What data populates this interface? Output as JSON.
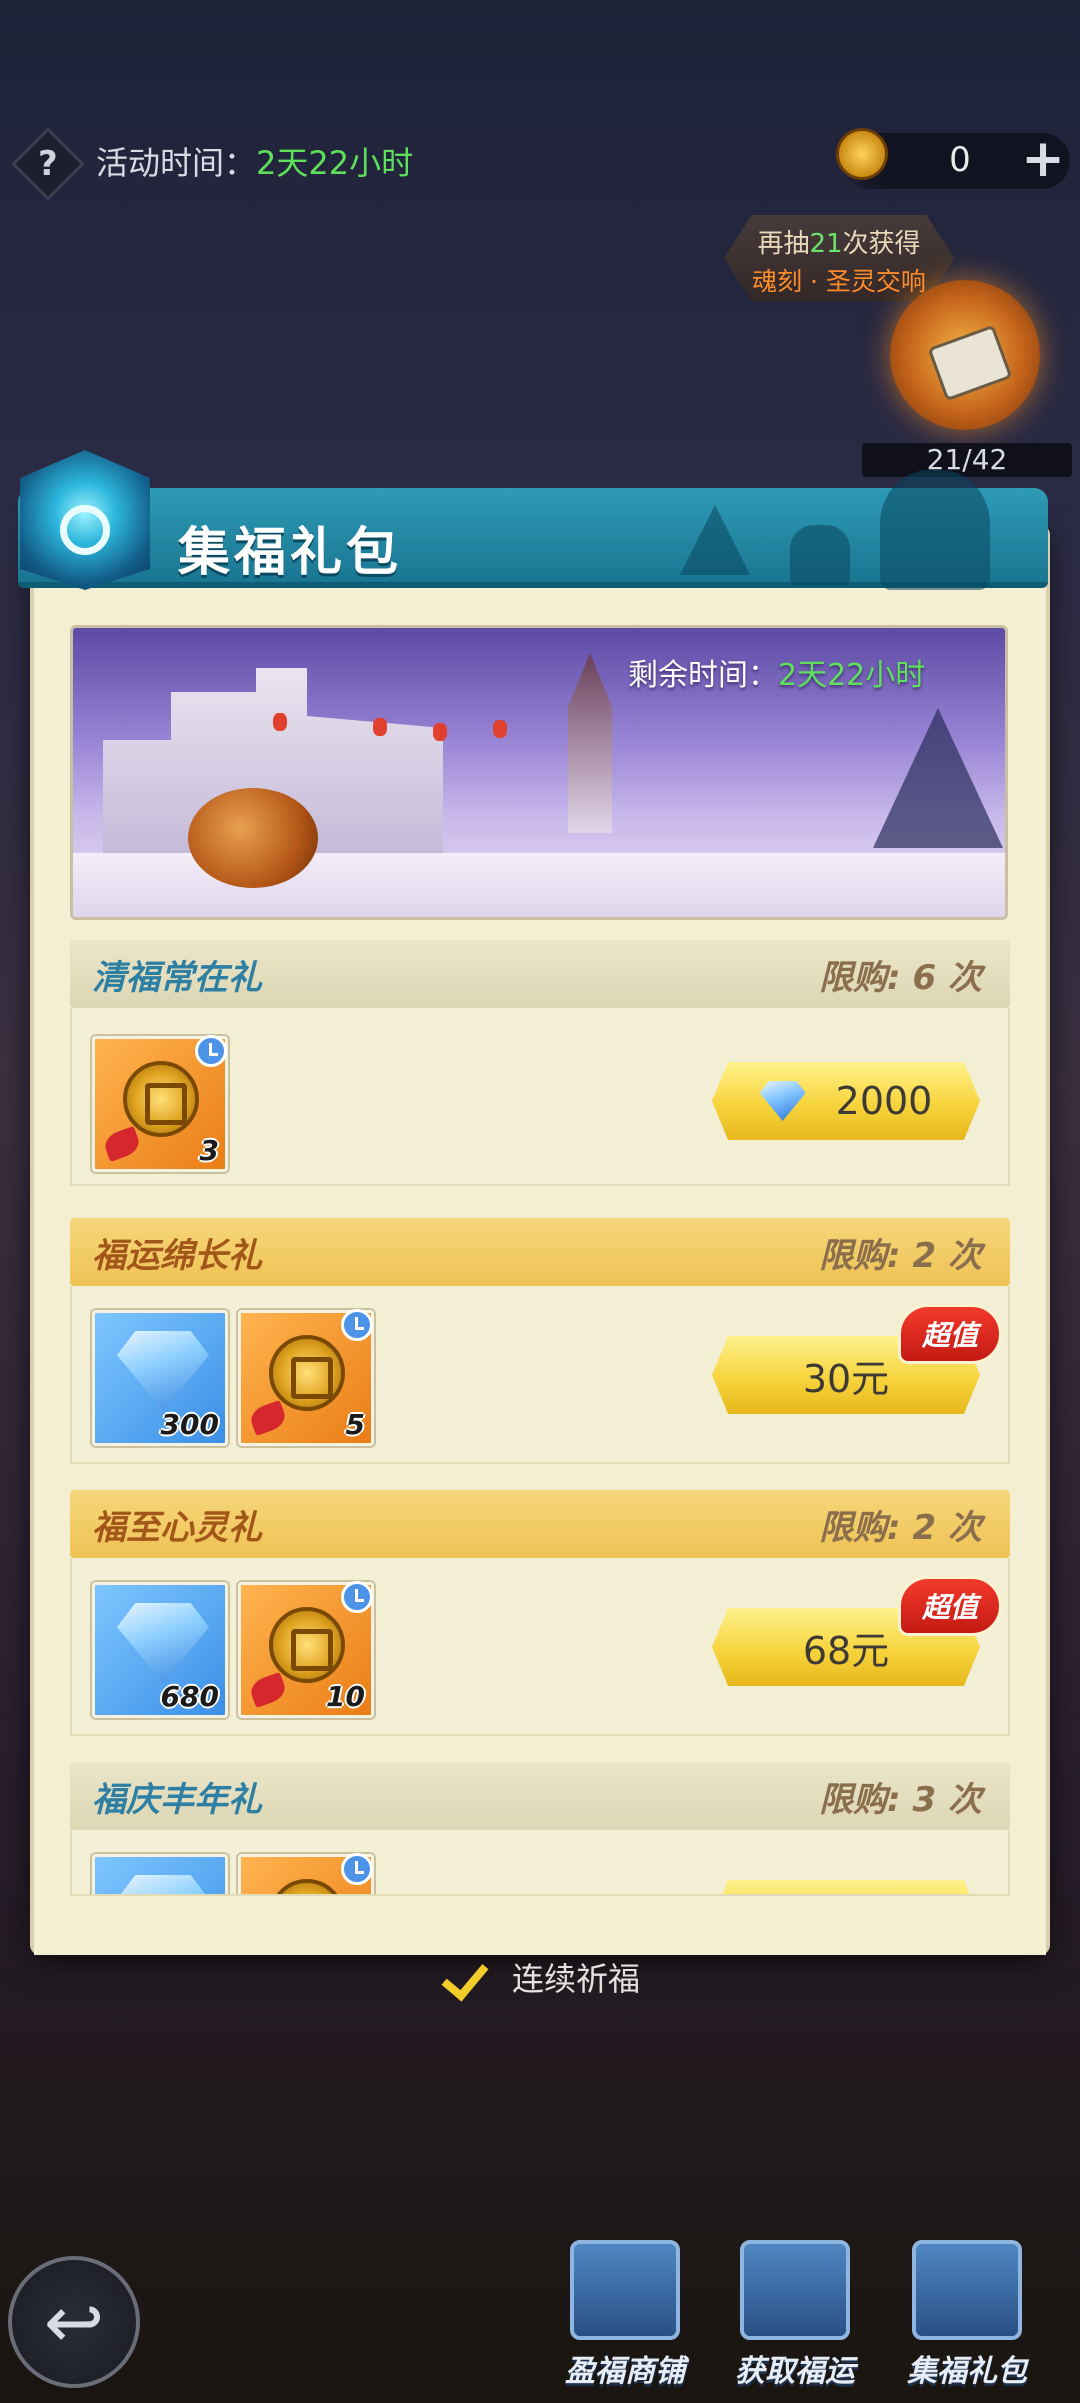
{
  "header": {
    "activity_label": "活动时间：",
    "activity_time": "2天22小时",
    "currency_value": "0",
    "plus_label": "+",
    "help_label": "?"
  },
  "draw_tip": {
    "prefix": "再抽",
    "count": "21",
    "suffix": "次获得",
    "reward_name": "魂刻 · 圣灵交响"
  },
  "progress": {
    "text": "21/42",
    "current": 21,
    "total": 42
  },
  "panel": {
    "title": "集福礼包",
    "banner_time_label": "剩余时间：",
    "banner_time": "2天22小时"
  },
  "packs": [
    {
      "name": "清福常在礼",
      "limit": "限购: 6 次",
      "items": [
        {
          "type": "fortune-coin",
          "qty": "3"
        }
      ],
      "price": "2000",
      "price_currency": "diamond-icon"
    },
    {
      "name": "福运绵长礼",
      "limit": "限购: 2 次",
      "items": [
        {
          "type": "diamond",
          "qty": "300"
        },
        {
          "type": "fortune-coin",
          "qty": "5"
        }
      ],
      "price": "30元",
      "badge": "超值"
    },
    {
      "name": "福至心灵礼",
      "limit": "限购: 2 次",
      "items": [
        {
          "type": "diamond",
          "qty": "680"
        },
        {
          "type": "fortune-coin",
          "qty": "10"
        }
      ],
      "price": "68元",
      "badge": "超值"
    },
    {
      "name": "福庆丰年礼",
      "limit": "限购: 3 次"
    }
  ],
  "toggle": {
    "label": "连续祈福",
    "checked": true
  },
  "bottom_nav": [
    {
      "label": "盈福商铺",
      "icon": "shop-chest-icon"
    },
    {
      "label": "获取福运",
      "icon": "book-icon"
    },
    {
      "label": "集福礼包",
      "icon": "gift-box-icon"
    }
  ],
  "colors": {
    "accent_green": "#5fe05a",
    "header_blue": "#2e9bb5",
    "price_gold": "#f7d43c",
    "badge_red": "#f33a2c"
  }
}
